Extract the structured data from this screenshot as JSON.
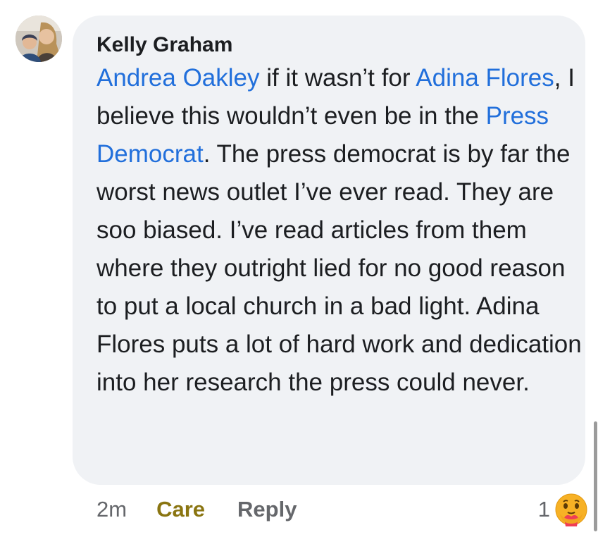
{
  "comment": {
    "author": "Kelly Graham",
    "segments": [
      {
        "text": "Andrea Oakley",
        "type": "mention"
      },
      {
        "text": " if it wasn’t for ",
        "type": "text"
      },
      {
        "text": "Adina Flores",
        "type": "mention"
      },
      {
        "text": ", I believe this wouldn’t even be in the ",
        "type": "text"
      },
      {
        "text": "Press Democrat",
        "type": "mention"
      },
      {
        "text": ". The press democrat is by far the worst news outlet I’ve ever read. They are soo biased. I’ve read articles from them where they outright lied for no good reason to put a local church in a bad light. Adina Flores puts a lot of hard work and dedication into her research the press could never.",
        "type": "text"
      }
    ]
  },
  "footer": {
    "time": "2m",
    "care_label": "Care",
    "reply_label": "Reply"
  },
  "reaction": {
    "count": "1",
    "icon": "care-emoji-icon"
  },
  "colors": {
    "mention": "#216fdb",
    "care": "#8a7511",
    "bubble": "#f0f2f5",
    "secondary_text": "#65676b"
  }
}
